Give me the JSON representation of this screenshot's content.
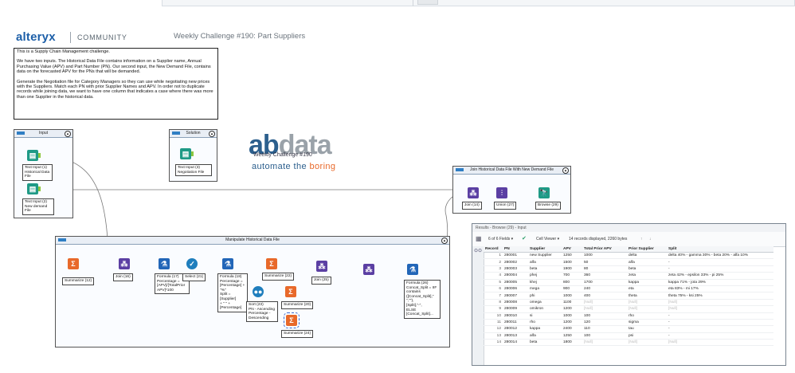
{
  "brand": {
    "logo": "alteryx",
    "community": "COMMUNITY"
  },
  "challenge_title": "Weekly Challenge #190: Part Suppliers",
  "description": {
    "line1": "This is a Supply Chain Management challenge.",
    "para2": "We have two inputs.  The Historical Data File contains information on a Supplier name, Annual Purchasing Value (APV) and Part Number (PN).  Our second input, the New Demand File, contains data on the forecasted APV for the PNs that will be demanded.",
    "para3": "Generate the Negotiation file for Category Managers so they can use while negotiating new prices with the Suppliers. Match each PN with prior Supplier Names and APV. In order not to duplicate records while joining data, we want to have one column that indicates a case where there was more than one Supplier in the historical data."
  },
  "containers": {
    "input": "Input",
    "solution": "Solution",
    "manipulate": "Manipulate  Historical  Data  File",
    "join": "Join  Historical  Data  File  With  New  Demand  File"
  },
  "tools": {
    "text_input_1": "Text Input (1)\nHistorical Data\nFile",
    "text_input_2": "Text Input (2)\nNew demand File",
    "text_input_3": "Text Input (3)\nNegotiation File",
    "summarize_12": "Summarize (12)",
    "join_16": "Join (16)",
    "formula_17": "Formula (17)\nPercentage =\n[APV]/[TotalPrior\nAPV]*100",
    "select_21": "Select (21)",
    "formula_18": "Formula (18)\nPercentage =\n[Percentage] +\n\"%\"\nSplit = [Supplier]\n+ \" \" +\n[Percentage]",
    "summarize_22": "Summarize (22)",
    "sort_23": "Sort (23)\nPN - Ascending\nPercentage -\nDescending",
    "summarize_20": "Summarize (20)",
    "summarize_24": "Summarize (24)",
    "join_25": "Join (25)",
    "formula_26": "Formula (26)\nConcat_Split = IIF\ncontains\n([Concat_Split],\"\n\",\"\"),\n[Split],\"-\",\nELSE\n[Concat_Split]...",
    "join_14": "Join (14)",
    "union_27": "Union (27)",
    "browse_29": "Browse (29)"
  },
  "abdata": {
    "ab": "ab",
    "data": "data",
    "weekly": "Weekly Challenge #190",
    "automate_1": "automate the ",
    "automate_2": "boring"
  },
  "results": {
    "title": "Results - Browse (29) - Input",
    "fields": "6 of 6 Fields",
    "viewer": "Cell Viewer",
    "summary": "14 records displayed, 2260 bytes",
    "columns": [
      "Record",
      "PN",
      "Supplier",
      "APV",
      "Total Prior APV",
      "Prior Supplier",
      "Split"
    ],
    "rows": [
      [
        "1",
        "280001",
        "new Supplier",
        "1250",
        "1000",
        "delta",
        "delta 40% - gamma 30% - beta 20% - alfa 10%"
      ],
      [
        "2",
        "280002",
        "alfa",
        "1500",
        "50",
        "alfa",
        "-"
      ],
      [
        "3",
        "280003",
        "beta",
        "1900",
        "80",
        "beta",
        "-"
      ],
      [
        "4",
        "280004",
        "phej",
        "700",
        "360",
        "zeta",
        "zeta 42% - epsilon 33% - pi 25%"
      ],
      [
        "5",
        "280005",
        "khej",
        "800",
        "1700",
        "kappa",
        "kappa 71% - jota 29%"
      ],
      [
        "6",
        "280006",
        "mega",
        "900",
        "240",
        "eta",
        "eta 83% - mi 17%"
      ],
      [
        "7",
        "280007",
        "phi",
        "1000",
        "400",
        "theta",
        "theta 75% - ksi 25%"
      ],
      [
        "8",
        "280008",
        "omega",
        "1100",
        "[Null]",
        "[Null]",
        "[Null]"
      ],
      [
        "9",
        "280009",
        "omikron",
        "1200",
        "[Null]",
        "[Null]",
        "[Null]"
      ],
      [
        "10",
        "280010",
        "si",
        "1000",
        "100",
        "rho",
        "-"
      ],
      [
        "11",
        "280011",
        "rho",
        "1200",
        "120",
        "sigma",
        "-"
      ],
      [
        "12",
        "280012",
        "kappa",
        "2400",
        "110",
        "tau",
        "-"
      ],
      [
        "13",
        "280013",
        "alfa",
        "1250",
        "100",
        "psi",
        "-"
      ],
      [
        "14",
        "280014",
        "beta",
        "1800",
        "[Null]",
        "[Null]",
        "[Null]"
      ]
    ]
  }
}
